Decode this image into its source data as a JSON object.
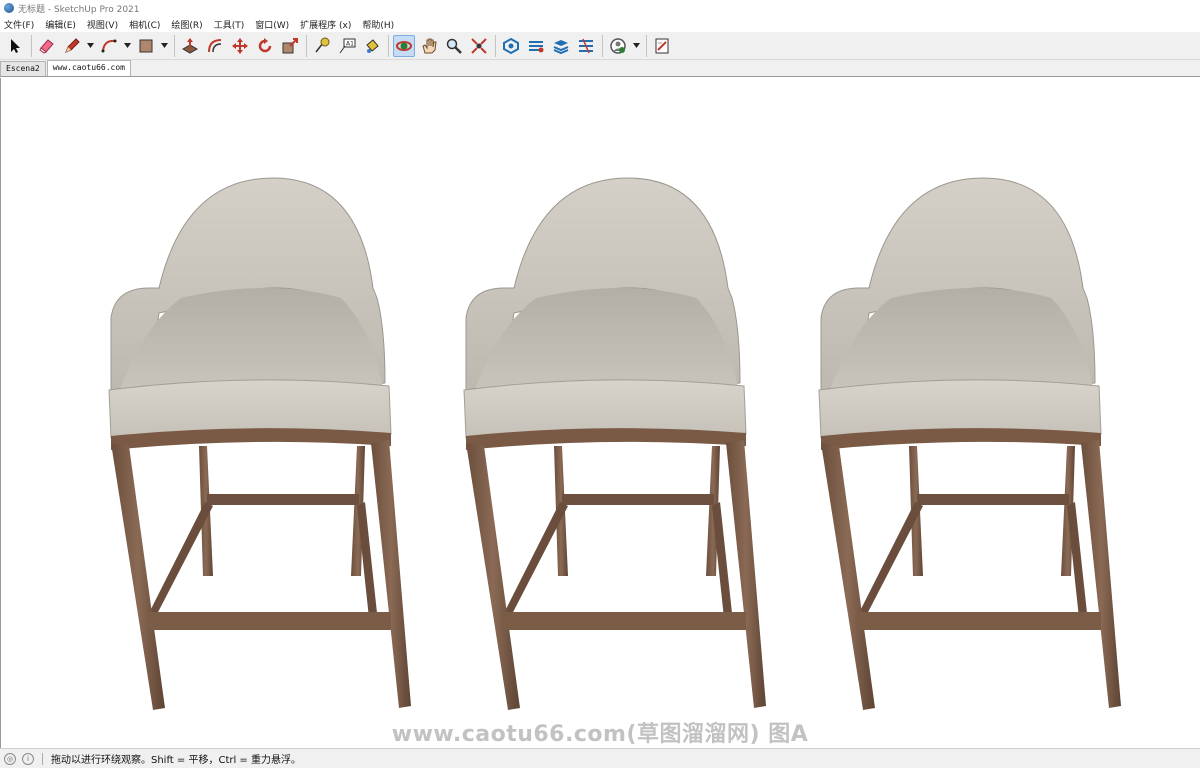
{
  "window": {
    "title": "无标题 - SketchUp Pro 2021"
  },
  "menu": [
    {
      "id": "file",
      "label": "文件(F)"
    },
    {
      "id": "edit",
      "label": "编辑(E)"
    },
    {
      "id": "view",
      "label": "视图(V)"
    },
    {
      "id": "camera",
      "label": "相机(C)"
    },
    {
      "id": "draw",
      "label": "绘图(R)"
    },
    {
      "id": "tools",
      "label": "工具(T)"
    },
    {
      "id": "window",
      "label": "窗口(W)"
    },
    {
      "id": "extensions",
      "label": "扩展程序 (x)"
    },
    {
      "id": "help",
      "label": "帮助(H)"
    }
  ],
  "toolbar": {
    "tools": [
      "select-tool-icon",
      "eraser-tool-icon",
      "pencil-tool-icon",
      "arc-tool-icon",
      "rectangle-tool-icon",
      "push-pull-tool-icon",
      "offset-tool-icon",
      "move-tool-icon",
      "rotate-tool-icon",
      "scale-tool-icon",
      "tape-measure-tool-icon",
      "text-tool-icon",
      "paint-bucket-tool-icon",
      "orbit-tool-icon",
      "pan-tool-icon",
      "zoom-tool-icon",
      "zoom-extents-tool-icon",
      "warehouse-icon",
      "extension-warehouse-icon",
      "layout-icon",
      "extension-manager-icon",
      "profile-icon",
      "send-to-layout-icon"
    ],
    "active_tool": "orbit-tool-icon"
  },
  "scenes": [
    {
      "label": "Escena2",
      "selected": false
    },
    {
      "label": "www.caotu66.com",
      "selected": true
    }
  ],
  "viewport": {
    "model": "bar-stools",
    "count": 3,
    "colors": {
      "upholstery": "#cfcbc3",
      "upholstery_shadow": "#a9a59d",
      "wood": "#7a5a45",
      "wood_dark": "#5b4131"
    }
  },
  "watermark": "www.caotu66.com(草图溜溜网) 图A",
  "status": {
    "message": "拖动以进行环绕观察。Shift = 平移，Ctrl = 重力悬浮。"
  }
}
